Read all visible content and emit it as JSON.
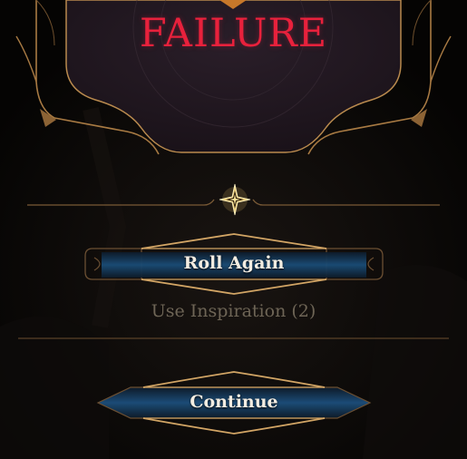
{
  "roll_result": {
    "title": "FAILURE"
  },
  "actions": {
    "roll_again_label": "Roll Again",
    "inspiration_label": "Use Inspiration (2)",
    "continue_label": "Continue"
  },
  "icons": {
    "inspiration": "inspiration-star-icon"
  },
  "colors": {
    "failure_red": "#e8213c",
    "gold_trim": "#c89a5a",
    "button_blue": "#1a4d78",
    "muted_text": "#6e6556",
    "button_text": "#f3ede2"
  }
}
